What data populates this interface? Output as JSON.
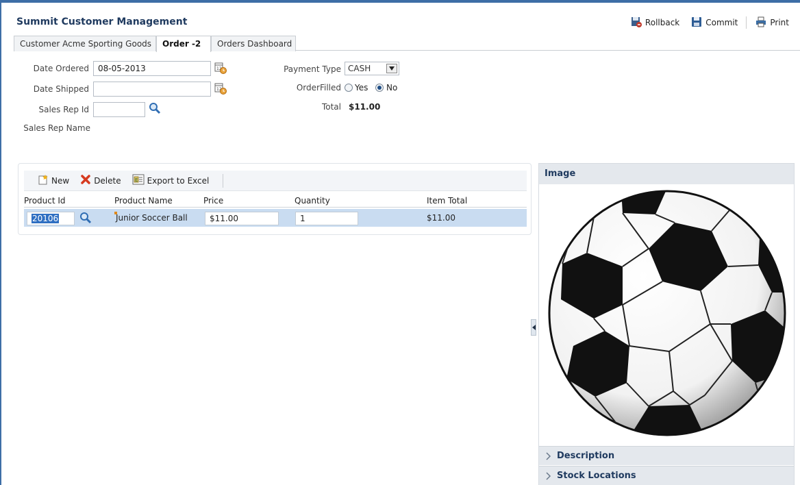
{
  "app": {
    "title": "Summit Customer Management"
  },
  "toolbar": {
    "rollback": "Rollback",
    "commit": "Commit",
    "print": "Print"
  },
  "tabs": [
    {
      "label": "Customer Acme Sporting Goods"
    },
    {
      "label": "Order -2",
      "active": true
    },
    {
      "label": "Orders Dashboard"
    }
  ],
  "form": {
    "date_ordered_label": "Date Ordered",
    "date_ordered_value": "08-05-2013",
    "date_shipped_label": "Date Shipped",
    "date_shipped_value": "",
    "sales_rep_id_label": "Sales Rep Id",
    "sales_rep_id_value": "",
    "sales_rep_name_label": "Sales Rep Name",
    "payment_type_label": "Payment Type",
    "payment_type_value": "CASH",
    "order_filled_label": "OrderFilled",
    "order_filled_yes": "Yes",
    "order_filled_no": "No",
    "order_filled_selected": "No",
    "total_label": "Total",
    "total_value": "$11.00"
  },
  "products": {
    "toolbar": {
      "new": "New",
      "delete": "Delete",
      "export": "Export to Excel"
    },
    "columns": [
      "Product Id",
      "Product Name",
      "Price",
      "Quantity",
      "Item Total"
    ],
    "rows": [
      {
        "product_id": "20106",
        "product_name": "Junior Soccer Ball",
        "price": "$11.00",
        "quantity": "1",
        "item_total": "$11.00"
      }
    ]
  },
  "side_panel": {
    "image_header": "Image",
    "image_icon": "soccer-ball-image",
    "description": "Description",
    "stock_locations": "Stock Locations"
  },
  "colors": {
    "accent": "#3e6ea6",
    "title": "#1f3a5f",
    "row_selected": "#c9dcf1"
  }
}
